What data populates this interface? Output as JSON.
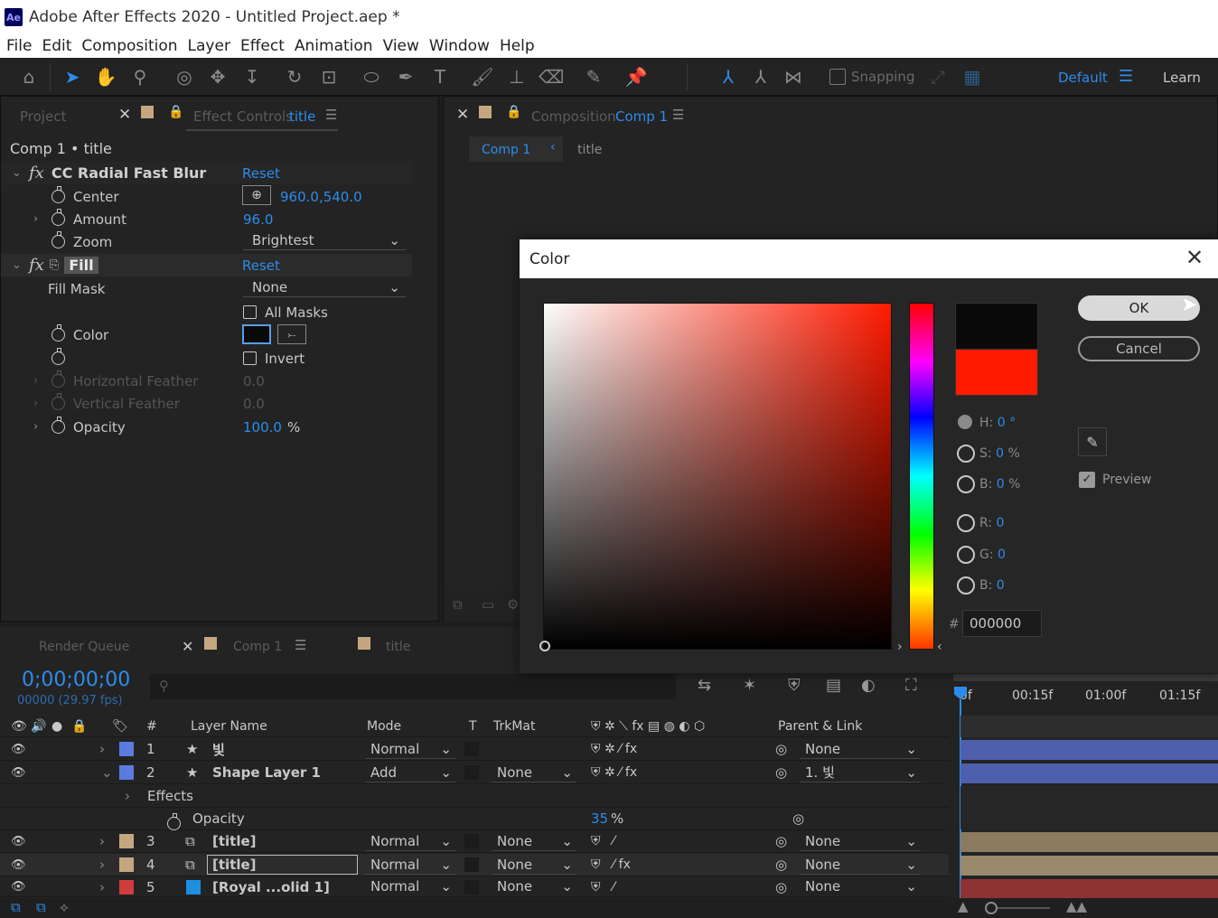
{
  "titlebar": {
    "logo": "Ae",
    "title": "Adobe After Effects 2020 - Untitled Project.aep *"
  },
  "menu": [
    "File",
    "Edit",
    "Composition",
    "Layer",
    "Effect",
    "Animation",
    "View",
    "Window",
    "Help"
  ],
  "toolbar": {
    "snapping_label": "Snapping",
    "workspace": "Default",
    "learn": "Learn"
  },
  "left_panel": {
    "tab_project": "Project",
    "tab_effect_controls": "Effect Controls",
    "tab_effect_controls_layer": "title",
    "breadcrumb": "Comp 1 • title",
    "effects": [
      {
        "name": "CC Radial Fast Blur",
        "reset": "Reset",
        "props": {
          "center_label": "Center",
          "center_value": "960.0,540.0",
          "amount_label": "Amount",
          "amount_value": "96.0",
          "zoom_label": "Zoom",
          "zoom_value": "Brightest"
        }
      },
      {
        "name": "Fill",
        "reset": "Reset",
        "props": {
          "fill_mask_label": "Fill Mask",
          "fill_mask_value": "None",
          "all_masks_label": "All Masks",
          "color_label": "Color",
          "invert_label": "Invert",
          "hfeather_label": "Horizontal Feather",
          "hfeather_value": "0.0",
          "vfeather_label": "Vertical Feather",
          "vfeather_value": "0.0",
          "opacity_label": "Opacity",
          "opacity_value": "100.0",
          "opacity_unit": "%"
        }
      }
    ]
  },
  "comp_panel": {
    "tab_label": "Composition",
    "tab_comp": "Comp 1",
    "crumb_comp": "Comp 1",
    "crumb_layer": "title"
  },
  "color_dialog": {
    "title": "Color",
    "ok": "OK",
    "cancel": "Cancel",
    "preview": "Preview",
    "h_label": "H:",
    "h_value": "0",
    "h_unit": "°",
    "s_label": "S:",
    "s_value": "0",
    "s_unit": "%",
    "b_label": "B:",
    "b_value": "0",
    "b_unit": "%",
    "r_label": "R:",
    "r_value": "0",
    "g_label": "G:",
    "g_value": "0",
    "b2_label": "B:",
    "b2_value": "0",
    "hash": "#",
    "hex_value": "000000",
    "new_color": "#0a0a0a",
    "old_color": "#ff1a00"
  },
  "timeline": {
    "tab_render_queue": "Render Queue",
    "tab_comp1": "Comp 1",
    "tab_title": "title",
    "timecode": "0;00;00;00",
    "frames": "00000 (29.97 fps)",
    "ruler": [
      "0f",
      "00:15f",
      "01:00f",
      "01:15f"
    ],
    "headers": {
      "num": "#",
      "layer_name": "Layer Name",
      "mode": "Mode",
      "t": "T",
      "trkmat": "TrkMat",
      "parent": "Parent & Link"
    },
    "layers": [
      {
        "num": "1",
        "name": "빛",
        "mode": "Normal",
        "trkmat": "",
        "parent": "None",
        "color": "#5b7be0"
      },
      {
        "num": "2",
        "name": "Shape Layer 1",
        "mode": "Add",
        "trkmat": "None",
        "parent": "1. 빛",
        "color": "#5b7be0"
      },
      {
        "num": "3",
        "name": "[title]",
        "mode": "Normal",
        "trkmat": "None",
        "parent": "None",
        "color": "#c4a780"
      },
      {
        "num": "4",
        "name": "[title]",
        "mode": "Normal",
        "trkmat": "None",
        "parent": "None",
        "color": "#c4a780"
      },
      {
        "num": "5",
        "name": "[Royal ...olid 1]",
        "mode": "Normal",
        "trkmat": "None",
        "parent": "None",
        "color": "#d03c3c"
      }
    ],
    "sub_effects": "Effects",
    "sub_opacity": "Opacity",
    "sub_opacity_value": "35",
    "sub_opacity_unit": "%"
  }
}
